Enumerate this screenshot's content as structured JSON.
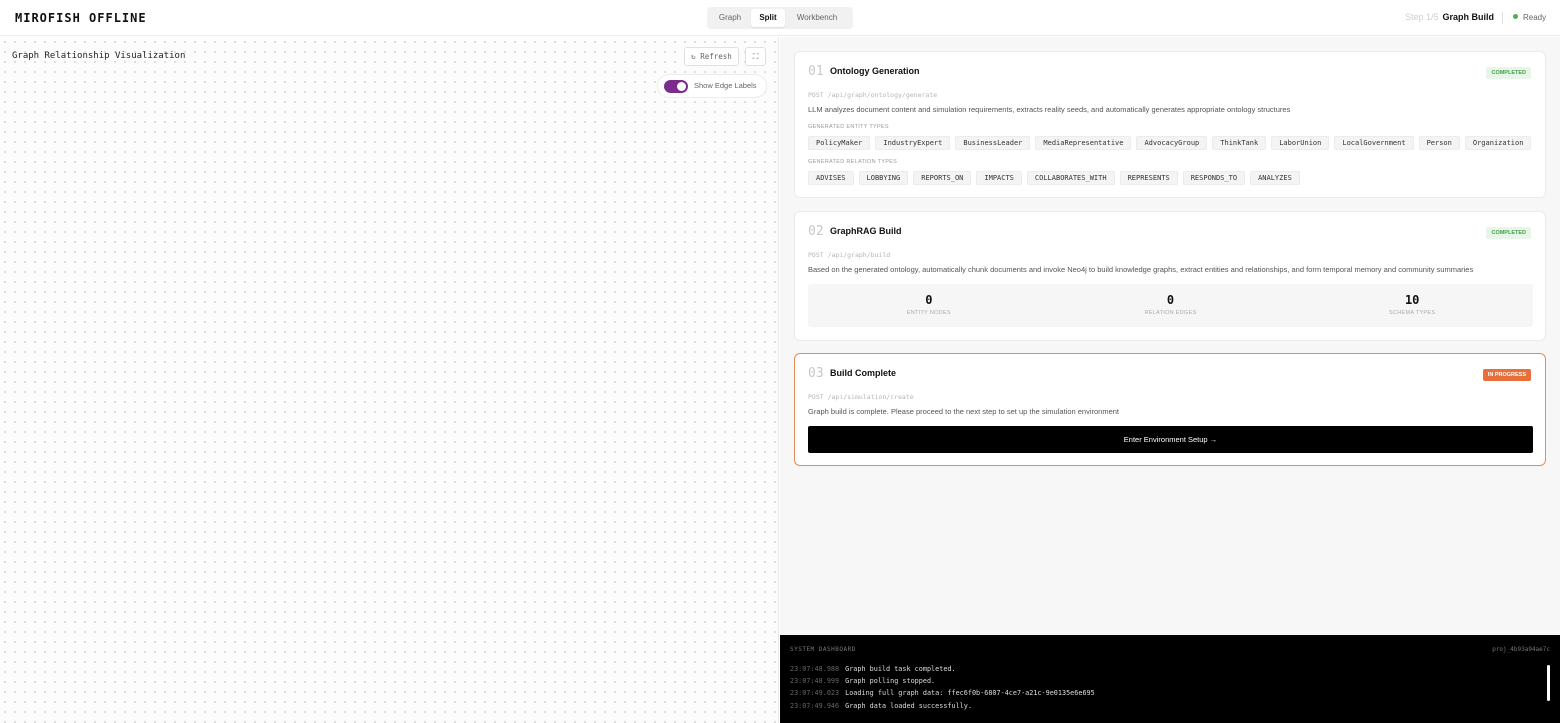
{
  "header": {
    "brand": "MIROFISH OFFLINE",
    "tabs": [
      "Graph",
      "Split",
      "Workbench"
    ],
    "step": "Step 1/5",
    "step_name": "Graph Build",
    "status": "Ready"
  },
  "graph_panel": {
    "title": "Graph Relationship Visualization",
    "refresh_label": "↻ Refresh",
    "fullscreen_label": "⛶",
    "edge_toggle_label": "Show Edge Labels",
    "edge_toggle_on": true
  },
  "cards": [
    {
      "num": "01",
      "title": "Ontology Generation",
      "badge": "COMPLETED",
      "api": "POST /api/graph/ontology/generate",
      "desc": "LLM analyzes document content and simulation requirements, extracts reality seeds, and automatically generates appropriate ontology structures",
      "entity_label": "GENERATED ENTITY TYPES",
      "entity_types": [
        "PolicyMaker",
        "IndustryExpert",
        "BusinessLeader",
        "MediaRepresentative",
        "AdvocacyGroup",
        "ThinkTank",
        "LaborUnion",
        "LocalGovernment",
        "Person",
        "Organization"
      ],
      "relation_label": "GENERATED RELATION TYPES",
      "relation_types": [
        "ADVISES",
        "LOBBYING",
        "REPORTS_ON",
        "IMPACTS",
        "COLLABORATES_WITH",
        "REPRESENTS",
        "RESPONDS_TO",
        "ANALYZES"
      ]
    },
    {
      "num": "02",
      "title": "GraphRAG Build",
      "badge": "COMPLETED",
      "api": "POST /api/graph/build",
      "desc": "Based on the generated ontology, automatically chunk documents and invoke Neo4j to build knowledge graphs, extract entities and relationships, and form temporal memory and community summaries",
      "stats": [
        {
          "value": "0",
          "label": "ENTITY NODES"
        },
        {
          "value": "0",
          "label": "RELATION EDGES"
        },
        {
          "value": "10",
          "label": "SCHEMA TYPES"
        }
      ]
    },
    {
      "num": "03",
      "title": "Build Complete",
      "badge": "IN PROGRESS",
      "api": "POST /api/simulation/create",
      "desc": "Graph build is complete. Please proceed to the next step to set up the simulation environment",
      "cta": "Enter Environment Setup →"
    }
  ],
  "terminal": {
    "title": "SYSTEM DASHBOARD",
    "project_id": "proj_4b93a94ae7c",
    "logs": [
      {
        "time": "23:07:48.988",
        "text": "Graph build task completed."
      },
      {
        "time": "23:07:48.999",
        "text": "Graph polling stopped."
      },
      {
        "time": "23:07:49.023",
        "text": "Loading full graph data: ffec6f0b-6807-4ce7-a21c-9e0135e6e695"
      },
      {
        "time": "23:07:49.946",
        "text": "Graph data loaded successfully."
      }
    ]
  },
  "colors": {
    "accent_purple": "#7b2d8e",
    "in_progress": "#e76f3c",
    "completed": "#43a047",
    "ready_dot": "#4caf50"
  }
}
